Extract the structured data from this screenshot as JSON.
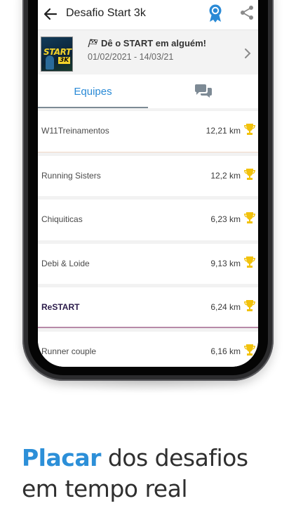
{
  "appbar": {
    "title": "Desafio Start 3k",
    "back_icon": "arrow-left-icon",
    "medal_icon": "medal-icon",
    "share_icon": "share-icon"
  },
  "challenge": {
    "thumbnail_text_1": "START",
    "thumbnail_text_2": "3K",
    "flag_icon": "checkered-flag-icon",
    "name": "Dê o START em alguém!",
    "dates": "01/02/2021 - 14/03/21"
  },
  "tabs": {
    "equipes": "Equipes",
    "chat_icon": "chat-bubbles-icon"
  },
  "teams": [
    {
      "name": "W11Treinamentos",
      "distance": "12,21 km"
    },
    {
      "name": "Running Sisters",
      "distance": "12,2 km"
    },
    {
      "name": "Chiquiticas",
      "distance": "6,23 km"
    },
    {
      "name": "Debi & Loide",
      "distance": "9,13 km"
    },
    {
      "name": "ReSTART",
      "distance": "6,24 km"
    },
    {
      "name": "Runner couple",
      "distance": "6,16 km"
    }
  ],
  "caption": {
    "highlight": "Placar",
    "rest": " dos desafios",
    "line2": "em tempo real"
  },
  "colors": {
    "accent": "#2c8fd8",
    "trophy": "#f2c20c",
    "phone": "#2c2c2e"
  }
}
